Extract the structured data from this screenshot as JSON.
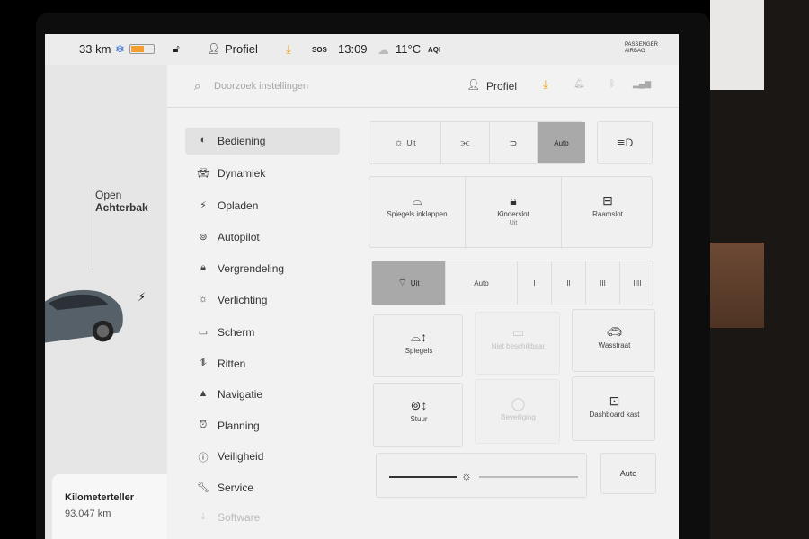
{
  "status_bar": {
    "range": "33 km",
    "profile": "Profiel",
    "time": "13:09",
    "temperature": "11°C",
    "aqi_label": "AQI",
    "sos_label": "SOS",
    "airbag_text": "PASSENGER AIRBAG"
  },
  "car_panel": {
    "open_label": "Open",
    "trunk_label": "Achterbak",
    "odometer_title": "Kilometerteller",
    "odometer_value": "93.047 km"
  },
  "topbar": {
    "search_placeholder": "Doorzoek instellingen",
    "profile": "Profiel"
  },
  "menu": {
    "items": [
      {
        "label": "Bediening",
        "icon": "toggle-icon",
        "active": true
      },
      {
        "label": "Dynamiek",
        "icon": "car-icon"
      },
      {
        "label": "Opladen",
        "icon": "bolt-icon"
      },
      {
        "label": "Autopilot",
        "icon": "steering-wheel-icon"
      },
      {
        "label": "Vergrendeling",
        "icon": "lock-icon"
      },
      {
        "label": "Verlichting",
        "icon": "sun-icon"
      },
      {
        "label": "Scherm",
        "icon": "display-icon"
      },
      {
        "label": "Ritten",
        "icon": "trips-icon"
      },
      {
        "label": "Navigatie",
        "icon": "navigation-icon"
      },
      {
        "label": "Planning",
        "icon": "alarm-clock-icon"
      },
      {
        "label": "Veiligheid",
        "icon": "info-circle-icon"
      },
      {
        "label": "Service",
        "icon": "wrench-icon"
      },
      {
        "label": "Software",
        "icon": "download-icon"
      }
    ]
  },
  "lights": {
    "off": "Uit",
    "auto": "Auto",
    "selected": "Auto"
  },
  "tiles_row1": {
    "mirrors_fold": "Spiegels inklappen",
    "child_lock": "Kinderslot",
    "child_lock_state": "Uit",
    "window_lock": "Raamslot"
  },
  "wipers": {
    "off": "Uit",
    "auto": "Auto",
    "speeds": [
      "I",
      "II",
      "III",
      "IIII"
    ],
    "selected": "Uit"
  },
  "tiles_grid": {
    "mirrors": "Spiegels",
    "not_available": "Niet beschikbaar",
    "car_wash": "Wasstraat",
    "steering": "Stuur",
    "glovebox_light": "Beveiliging",
    "dashboard_box": "Dashboard kast"
  },
  "brightness": {
    "auto": "Auto"
  }
}
